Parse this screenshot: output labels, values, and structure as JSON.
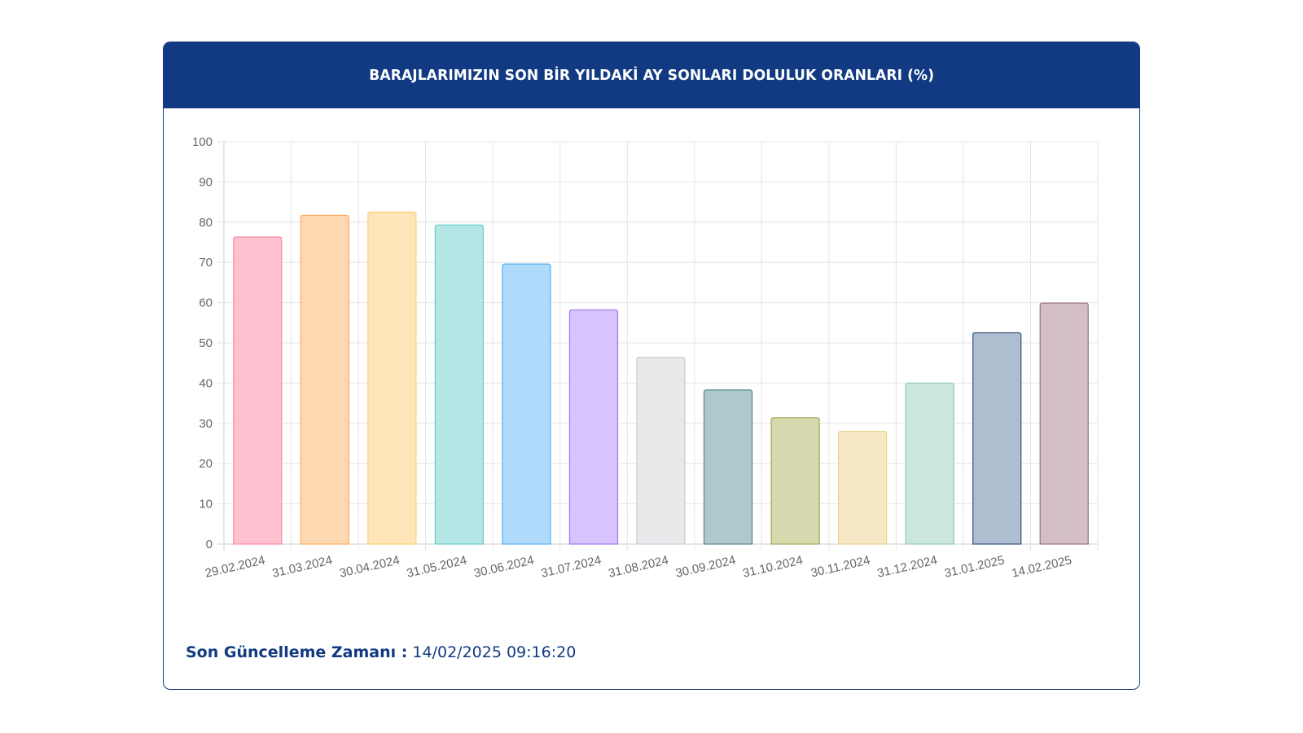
{
  "header": {
    "title": "BARAJLARIMIZIN SON BİR YILDAKİ AY SONLARI DOLULUK ORANLARI (%)"
  },
  "footer": {
    "label": "Son Güncelleme Zamanı :",
    "value": "14/02/2025 09:16:20"
  },
  "colors": {
    "header_bg": "#113a82",
    "footer_text": "#113a82"
  },
  "chart_data": {
    "type": "bar",
    "title": "BARAJLARIMIZIN SON BİR YILDAKİ AY SONLARI DOLULUK ORANLARI (%)",
    "xlabel": "",
    "ylabel": "",
    "ylim": [
      0,
      100
    ],
    "yticks": [
      0,
      10,
      20,
      30,
      40,
      50,
      60,
      70,
      80,
      90,
      100
    ],
    "grid": true,
    "categories": [
      "29.02.2024",
      "31.03.2024",
      "30.04.2024",
      "31.05.2024",
      "30.06.2024",
      "31.07.2024",
      "31.08.2024",
      "30.09.2024",
      "31.10.2024",
      "30.11.2024",
      "31.12.2024",
      "31.01.2025",
      "14.02.2025"
    ],
    "series": [
      {
        "values": [
          76.3,
          81.7,
          82.5,
          79.3,
          69.6,
          58.2,
          46.4,
          38.3,
          31.4,
          28.0,
          40.0,
          52.5,
          59.9
        ]
      }
    ],
    "bar_fills": [
      "#fec1cf",
      "#fed8b1",
      "#fee6b8",
      "#b5e6e6",
      "#b0dafb",
      "#d7c3fd",
      "#e8e9eb",
      "#afc8cd",
      "#d6d9ae",
      "#f6e8c4",
      "#cbe6dd",
      "#aebdd0",
      "#d4bec7"
    ],
    "bar_strokes": [
      "#fd8fa8",
      "#fdae63",
      "#fed17b",
      "#70cdcd",
      "#5fb4f2",
      "#a97cf5",
      "#cdced3",
      "#5e8d95",
      "#a5ab5e",
      "#ecd394",
      "#95cdb8",
      "#3f5a82",
      "#9e7a88"
    ]
  }
}
